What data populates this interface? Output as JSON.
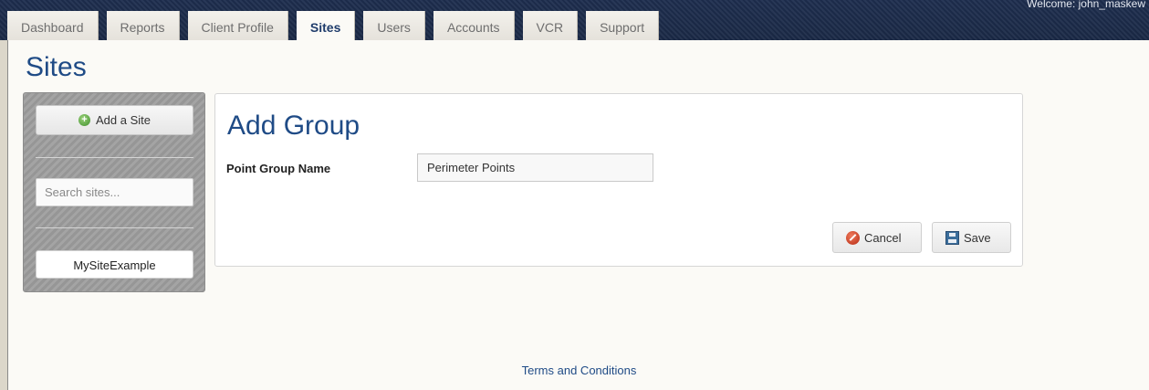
{
  "header": {
    "welcome_text": "Welcome: john_maskew"
  },
  "nav": {
    "tabs": [
      {
        "label": "Dashboard"
      },
      {
        "label": "Reports"
      },
      {
        "label": "Client Profile"
      },
      {
        "label": "Sites",
        "active": true
      },
      {
        "label": "Users"
      },
      {
        "label": "Accounts"
      },
      {
        "label": "VCR"
      },
      {
        "label": "Support"
      }
    ]
  },
  "page": {
    "title": "Sites"
  },
  "sidebar": {
    "add_button_label": "Add a Site",
    "search_placeholder": "Search sites...",
    "sites": [
      {
        "label": "MySiteExample"
      }
    ]
  },
  "form": {
    "title": "Add Group",
    "field_label": "Point Group Name",
    "field_value": "Perimeter Points",
    "cancel_label": "Cancel",
    "save_label": "Save"
  },
  "footer": {
    "link_label": "Terms and Conditions"
  },
  "colors": {
    "brand_navy": "#1f4b86",
    "header_band": "#1d2d4e"
  }
}
